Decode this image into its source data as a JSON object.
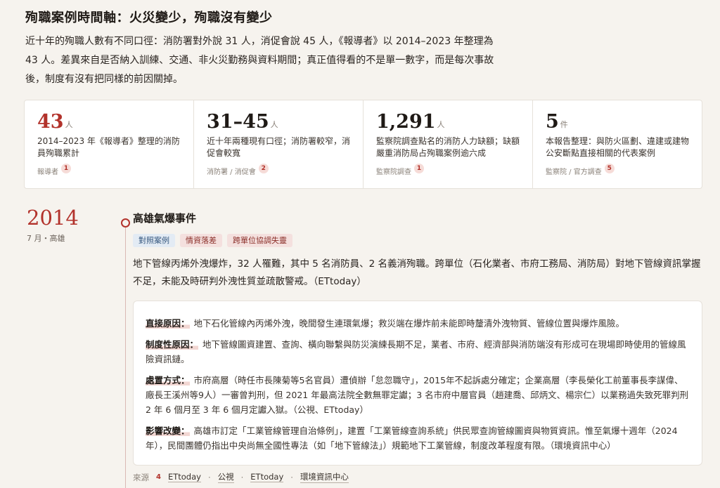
{
  "title": "殉職案例時間軸：火災變少，殉職沒有變少",
  "intro": "近十年的殉職人數有不同口徑：消防署對外說 31 人，消促會說 45 人，《報導者》以 2014–2023 年整理為 43 人。差異來自是否納入訓練、交通、非火災勤務與資料期間；真正值得看的不是單一數字，而是每次事故後，制度有沒有把同樣的前因關掉。",
  "stats": [
    {
      "num": "43",
      "unit": "人",
      "desc": "2014–2023 年《報導者》整理的消防員殉職累計",
      "src": "報導者",
      "count": "1"
    },
    {
      "num": "31–45",
      "unit": "人",
      "desc": "近十年兩種現有口徑；消防署較窄，消促會較寬",
      "src": "消防署 / 消促會",
      "count": "2"
    },
    {
      "num": "1,291",
      "unit": "人",
      "desc": "監察院調查點名的消防人力缺額；缺額嚴重消防局占殉職案例逾六成",
      "src": "監察院調查",
      "count": "1"
    },
    {
      "num": "5",
      "unit": "件",
      "desc": "本報告整理：與防火區劃、違建或建物公安斷點直接相關的代表案例",
      "src": "監察院 / 官方調查",
      "count": "5"
    }
  ],
  "event": {
    "year": "2014",
    "sub": "7 月・高雄",
    "title": "高雄氣爆事件",
    "tags": [
      "對照案例",
      "情資落差",
      "跨單位協調失靈"
    ],
    "body": "地下管線丙烯外洩爆炸，32 人罹難，其中 5 名消防員、2 名義消殉職。跨單位（石化業者、市府工務局、消防局）對地下管線資訊掌握不足，未能及時研判外洩性質並疏散警戒。（ETtoday）",
    "details": [
      {
        "label": "直接原因：",
        "text": "地下石化管線內丙烯外洩，晚間發生連環氣爆；救災端在爆炸前未能即時釐清外洩物質、管線位置與爆炸風險。"
      },
      {
        "label": "制度性原因：",
        "text": "地下管線圖資建置、查詢、橫向聯繫與防災演練長期不足，業者、市府、經濟部與消防端沒有形成可在現場即時使用的管線風險資訊鏈。"
      },
      {
        "label": "處置方式：",
        "text": "市府高層（時任市長陳菊等5名官員）遭偵辦「怠忽職守」，2015年不起訴處分確定；企業高層（李長榮化工前董事長李謀偉、廠長王溪州等9人）一審曾判刑，但 2021 年最高法院全數無罪定讞；3 名市府中層官員（趙建喬、邱炳文、楊宗仁）以業務過失致死罪判刑 2 年 6 個月至 3 年 6 個月定讞入獄。（公視、ETtoday）"
      },
      {
        "label": "影響改變：",
        "text": "高雄市訂定「工業管線管理自治條例」，建置「工業管線查詢系統」供民眾查詢管線圖資與物質資訊。惟至氣爆十週年（2024年），民間團體仍指出中央尚無全國性專法（如「地下管線法」）規範地下工業管線，制度改革程度有限。（環境資訊中心）"
      }
    ],
    "sources_label": "來源",
    "sources_count": "4",
    "sources": [
      "ETtoday",
      "公視",
      "ETtoday",
      "環境資訊中心"
    ]
  }
}
